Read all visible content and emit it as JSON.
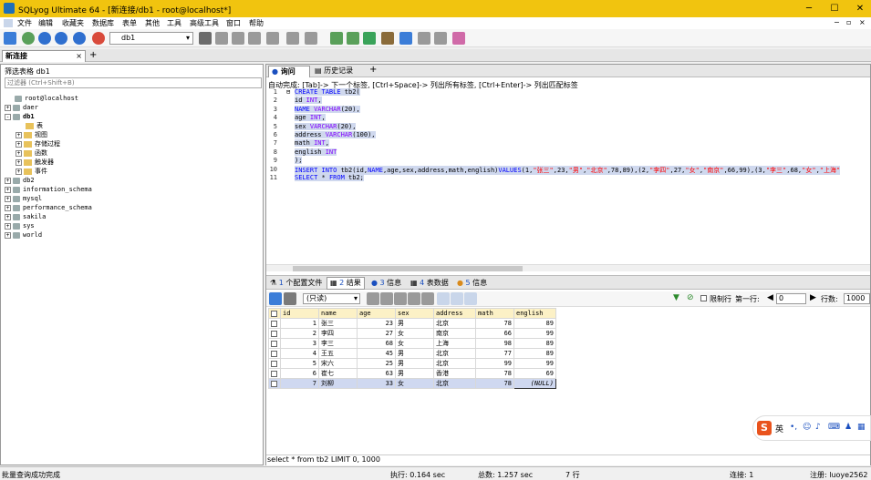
{
  "window": {
    "title": "SQLyog Ultimate 64 - [新连接/db1 - root@localhost*]"
  },
  "menu": [
    "文件",
    "编辑",
    "收藏夹",
    "数据库",
    "表单",
    "其他",
    "工具",
    "高级工具",
    "窗口",
    "帮助"
  ],
  "toolbar": {
    "db_selected": "db1"
  },
  "connection_tab": "新连接",
  "object_browser": {
    "header": "筛选表格 db1",
    "filter_placeholder": "过滤器 (Ctrl+Shift+B)",
    "tree": [
      {
        "label": "root@localhost",
        "kind": "server",
        "expand": ""
      },
      {
        "label": "daer",
        "kind": "db",
        "expand": "+"
      },
      {
        "label": "db1",
        "kind": "db",
        "expand": "-",
        "bold": true
      },
      {
        "label": "表",
        "kind": "folder",
        "expand": ""
      },
      {
        "label": "视图",
        "kind": "folder",
        "expand": "+"
      },
      {
        "label": "存储过程",
        "kind": "folder",
        "expand": "+"
      },
      {
        "label": "函数",
        "kind": "folder",
        "expand": "+"
      },
      {
        "label": "触发器",
        "kind": "folder",
        "expand": "+"
      },
      {
        "label": "事件",
        "kind": "folder",
        "expand": "+"
      },
      {
        "label": "db2",
        "kind": "db",
        "expand": "+"
      },
      {
        "label": "information_schema",
        "kind": "db",
        "expand": "+"
      },
      {
        "label": "mysql",
        "kind": "db",
        "expand": "+"
      },
      {
        "label": "performance_schema",
        "kind": "db",
        "expand": "+"
      },
      {
        "label": "sakila",
        "kind": "db",
        "expand": "+"
      },
      {
        "label": "sys",
        "kind": "db",
        "expand": "+"
      },
      {
        "label": "world",
        "kind": "db",
        "expand": "+"
      }
    ]
  },
  "query_tabs": [
    "询问",
    "历史记录"
  ],
  "autocomplete_hint": "自动完成: [Tab]-> 下一个标签, [Ctrl+Space]-> 列出所有标签, [Ctrl+Enter]-> 列出匹配标签",
  "editor_lines": [
    "1",
    "2",
    "3",
    "4",
    "5",
    "6",
    "7",
    "8",
    "9",
    "10",
    "11"
  ],
  "result_tabs": [
    {
      "num": "1",
      "label": "个配置文件"
    },
    {
      "num": "2",
      "label": "结果"
    },
    {
      "num": "3",
      "label": "信息"
    },
    {
      "num": "4",
      "label": "表数据"
    },
    {
      "num": "5",
      "label": "信息"
    }
  ],
  "result_toolbar": {
    "readonly": "(只读)",
    "limit_label": "限制行",
    "first_row_label": "第一行:",
    "first_row_value": "0",
    "row_count_label": "行数:",
    "row_count_value": "1000"
  },
  "result_table": {
    "columns": [
      "id",
      "name",
      "age",
      "sex",
      "address",
      "math",
      "english"
    ],
    "rows": [
      [
        "1",
        "张三",
        "23",
        "男",
        "北京",
        "78",
        "89"
      ],
      [
        "2",
        "李四",
        "27",
        "女",
        "南京",
        "66",
        "99"
      ],
      [
        "3",
        "李三",
        "68",
        "女",
        "上海",
        "98",
        "89"
      ],
      [
        "4",
        "王五",
        "45",
        "男",
        "北京",
        "77",
        "89"
      ],
      [
        "5",
        "宋六",
        "25",
        "男",
        "北京",
        "99",
        "99"
      ],
      [
        "6",
        "崔七",
        "63",
        "男",
        "香港",
        "78",
        "69"
      ],
      [
        "7",
        "刘柳",
        "33",
        "女",
        "北京",
        "78",
        "(NULL)"
      ]
    ]
  },
  "query_status": "select * from tb2 LIMIT 0, 1000",
  "statusbar": {
    "message": "批量查询成功完成",
    "exec_time": "执行: 0.164 sec",
    "total_time": "总数: 1.257 sec",
    "rows": "7 行",
    "connections": "连接: 1",
    "registered": "注册: luoye2562"
  },
  "ime": {
    "label": "英"
  }
}
